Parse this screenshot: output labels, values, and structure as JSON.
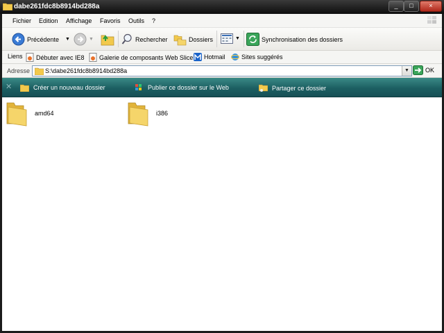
{
  "window": {
    "title": "dabe261fdc8b8914bd288a",
    "controls": {
      "minimize": "_",
      "maximize": "□",
      "close": "×"
    }
  },
  "menu": [
    "Fichier",
    "Edition",
    "Affichage",
    "Favoris",
    "Outils",
    "?"
  ],
  "toolbar": {
    "back": "Précédente",
    "search": "Rechercher",
    "folders": "Dossiers",
    "sync": "Synchronisation des dossiers"
  },
  "links": {
    "label": "Liens",
    "items": [
      "Débuter avec IE8",
      "Galerie de composants Web Slice",
      "Hotmail",
      "Sites suggérés"
    ]
  },
  "address": {
    "label": "Adresse",
    "value": "S:\\dabe261fdc8b8914bd288a",
    "go": "OK"
  },
  "tasks": [
    "Créer un nouveau dossier",
    "Publier ce dossier sur le Web",
    "Partager ce dossier"
  ],
  "files": [
    {
      "name": "amd64"
    },
    {
      "name": "i386"
    }
  ],
  "colors": {
    "task_bar": "#1c5f62",
    "title_bar": "#0d0d0d",
    "folder": "#f2c94c"
  }
}
